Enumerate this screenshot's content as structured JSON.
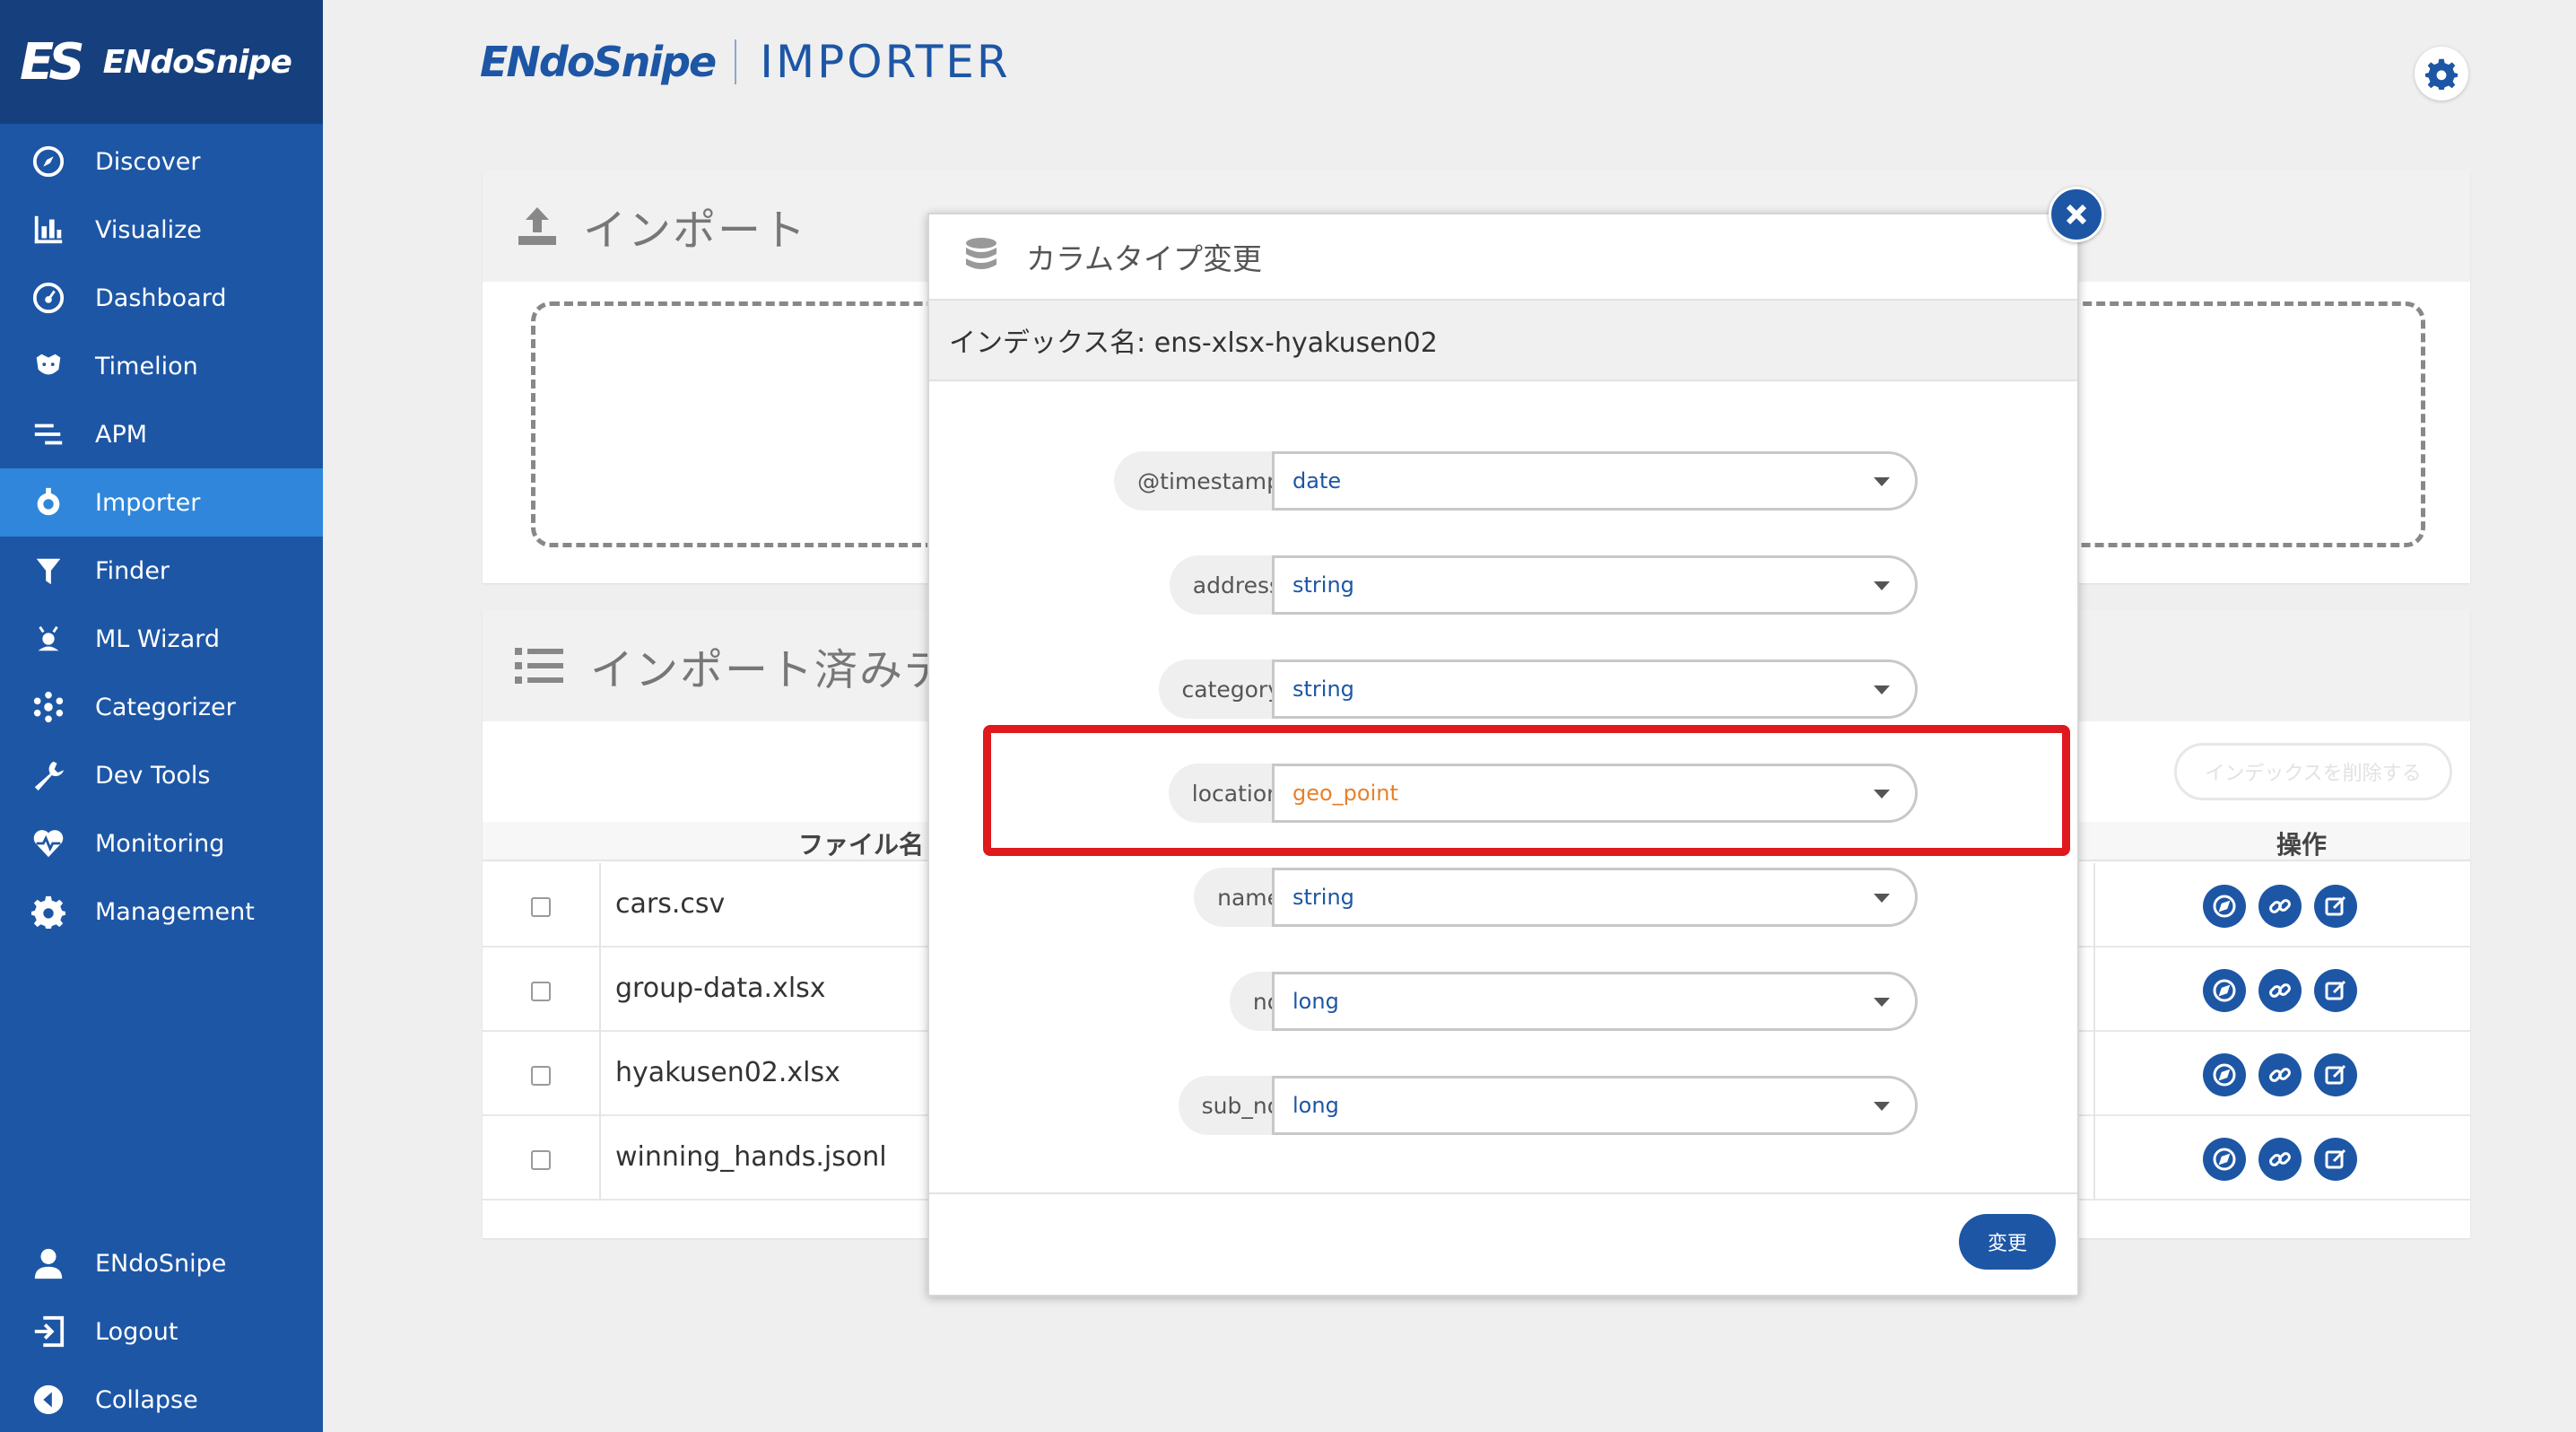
{
  "sidebar": {
    "brand_mark": "ES",
    "brand": "ENdoSnipe",
    "items": [
      {
        "label": "Discover",
        "icon": "compass-icon"
      },
      {
        "label": "Visualize",
        "icon": "bar-chart-icon"
      },
      {
        "label": "Dashboard",
        "icon": "dashboard-icon"
      },
      {
        "label": "Timelion",
        "icon": "timelion-icon"
      },
      {
        "label": "APM",
        "icon": "apm-icon"
      },
      {
        "label": "Importer",
        "icon": "importer-icon",
        "active": true
      },
      {
        "label": "Finder",
        "icon": "funnel-icon"
      },
      {
        "label": "ML Wizard",
        "icon": "wizard-icon"
      },
      {
        "label": "Categorizer",
        "icon": "categorizer-icon"
      },
      {
        "label": "Dev Tools",
        "icon": "wrench-icon"
      },
      {
        "label": "Monitoring",
        "icon": "heartbeat-icon"
      },
      {
        "label": "Management",
        "icon": "gear-icon"
      }
    ],
    "bottom_items": [
      {
        "label": "ENdoSnipe",
        "icon": "user-icon"
      },
      {
        "label": "Logout",
        "icon": "logout-icon"
      },
      {
        "label": "Collapse",
        "icon": "collapse-icon"
      }
    ]
  },
  "header": {
    "logo_brand": "ENdoSnipe",
    "logo_product": "IMPORTER"
  },
  "import_panel": {
    "title": "インポート"
  },
  "list_panel": {
    "title": "インポート済みデ",
    "delete_index_button": "インデックスを削除する",
    "columns": {
      "file": "ファイル名",
      "ops": "操作"
    },
    "rows": [
      {
        "file": "cars.csv"
      },
      {
        "file": "group-data.xlsx"
      },
      {
        "file": "hyakusen02.xlsx"
      },
      {
        "file": "winning_hands.jsonl"
      }
    ]
  },
  "modal": {
    "title": "カラムタイプ変更",
    "index_name": "インデックス名: ens-xlsx-hyakusen02",
    "fields": [
      {
        "name": "@timestamp",
        "type": "date"
      },
      {
        "name": "address",
        "type": "string"
      },
      {
        "name": "category",
        "type": "string"
      },
      {
        "name": "location",
        "type": "geo_point",
        "highlight": true
      },
      {
        "name": "name",
        "type": "string"
      },
      {
        "name": "no",
        "type": "long"
      },
      {
        "name": "sub_no",
        "type": "long"
      }
    ],
    "submit": "変更"
  },
  "colors": {
    "sidebar": "#1d56a5",
    "sidebar_brand": "#16407d",
    "active_item": "#2f86da",
    "accent": "#1d56a5",
    "highlight": "#e0191e",
    "changed_type": "#e8802a"
  }
}
